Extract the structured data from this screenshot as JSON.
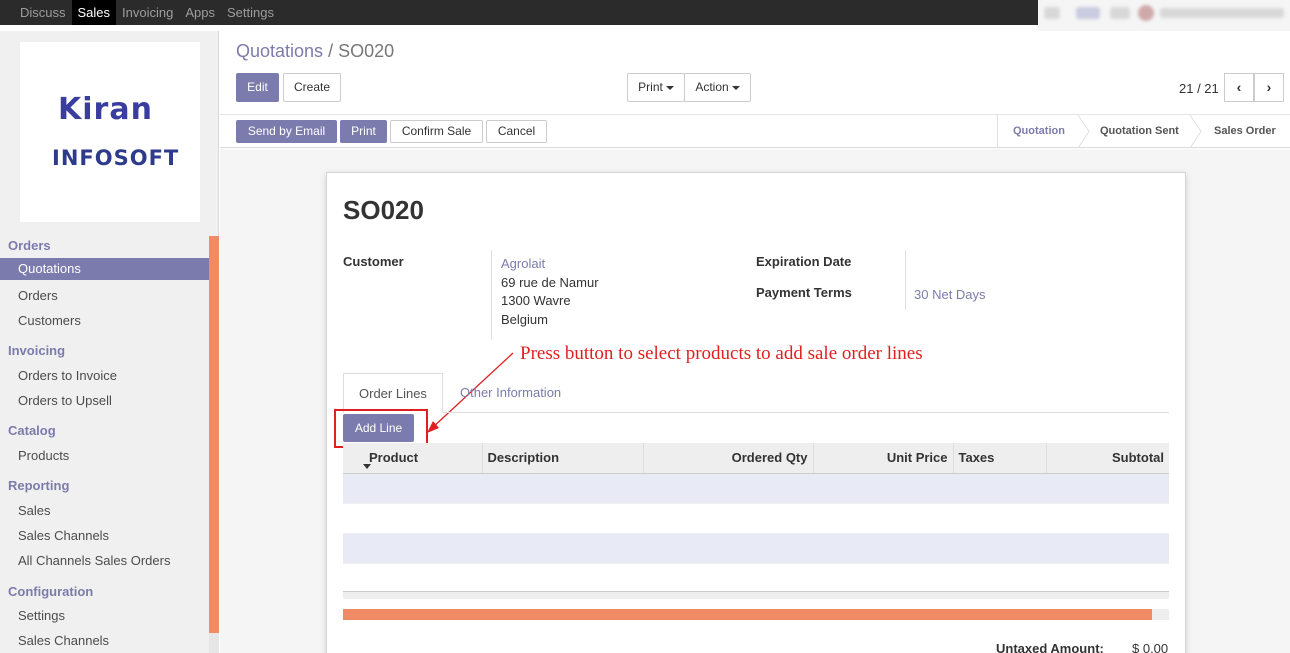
{
  "topbar": {
    "menu": [
      "Discuss",
      "Sales",
      "Invoicing",
      "Apps",
      "Settings"
    ],
    "active": "Sales"
  },
  "logo": {
    "line1": "Kiran",
    "line2": "INFOSOFT"
  },
  "sidebar": {
    "orders_title": "Orders",
    "orders": [
      "Quotations",
      "Orders",
      "Customers"
    ],
    "invoicing_title": "Invoicing",
    "invoicing": [
      "Orders to Invoice",
      "Orders to Upsell"
    ],
    "catalog_title": "Catalog",
    "catalog": [
      "Products"
    ],
    "reporting_title": "Reporting",
    "reporting": [
      "Sales",
      "Sales Channels",
      "All Channels Sales Orders"
    ],
    "configuration_title": "Configuration",
    "configuration": [
      "Settings",
      "Sales Channels"
    ]
  },
  "breadcrumb": {
    "parent": "Quotations",
    "sep": "/",
    "current": "SO020"
  },
  "toolbar": {
    "edit": "Edit",
    "create": "Create",
    "print": "Print",
    "action": "Action",
    "pager": "21 / 21",
    "prev": "‹",
    "next": "›"
  },
  "statusbar": {
    "send_email": "Send by Email",
    "print": "Print",
    "confirm": "Confirm Sale",
    "cancel": "Cancel",
    "stages": [
      "Quotation",
      "Quotation Sent",
      "Sales Order"
    ],
    "current_stage": "Quotation"
  },
  "form": {
    "title": "SO020",
    "customer_label": "Customer",
    "customer_name": "Agrolait",
    "address": [
      "69 rue de Namur",
      "1300 Wavre",
      "Belgium"
    ],
    "expiration_label": "Expiration Date",
    "payment_terms_label": "Payment Terms",
    "payment_terms": "30 Net Days"
  },
  "tabs": {
    "order_lines": "Order Lines",
    "other_info": "Other Information"
  },
  "add_line": "Add Line",
  "annotation": "Press button to select products to add sale order lines",
  "lines_table": {
    "columns": [
      "Product",
      "Description",
      "Ordered Qty",
      "Unit Price",
      "Taxes",
      "Subtotal"
    ]
  },
  "totals": {
    "untaxed_label": "Untaxed Amount:",
    "untaxed_value": "$ 0.00"
  },
  "colors": {
    "brand": "#7c7bad",
    "accent": "#f08b66",
    "annotation": "#e02020"
  }
}
